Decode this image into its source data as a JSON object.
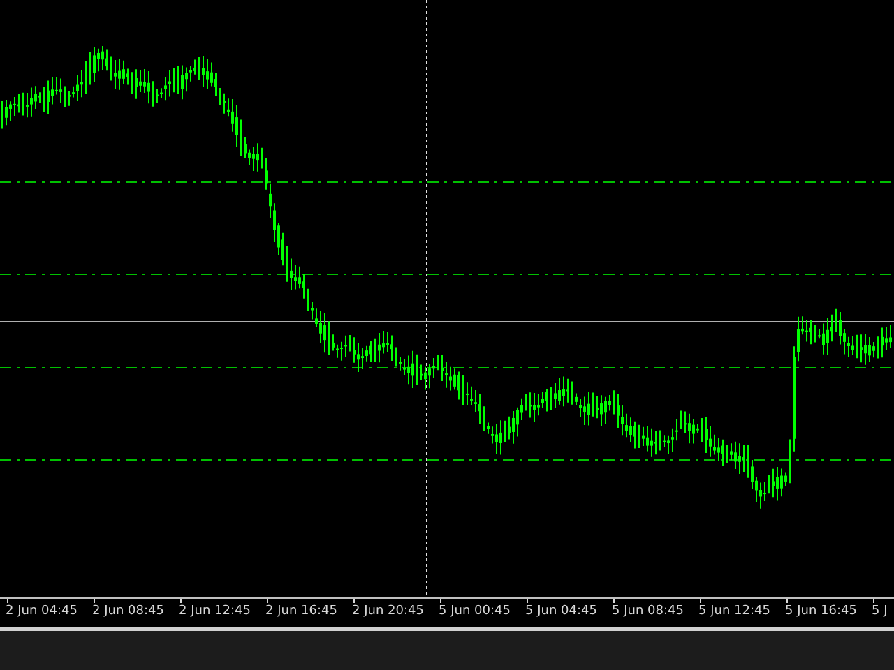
{
  "time_axis": {
    "labels": [
      "2 Jun 04:45",
      "2 Jun 08:45",
      "2 Jun 12:45",
      "2 Jun 16:45",
      "2 Jun 20:45",
      "5 Jun 00:45",
      "5 Jun 04:45",
      "5 Jun 08:45",
      "5 Jun 12:45",
      "5 Jun 16:45",
      "5 J"
    ]
  }
}
